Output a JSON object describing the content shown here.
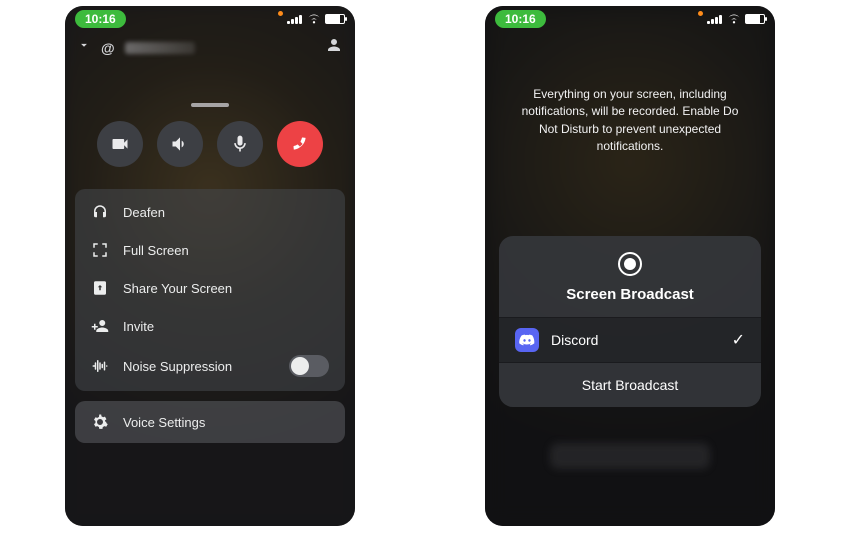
{
  "status": {
    "time": "10:16"
  },
  "left": {
    "header": {
      "at": "@"
    },
    "menu": {
      "deafen": "Deafen",
      "fullscreen": "Full Screen",
      "share": "Share Your Screen",
      "invite": "Invite",
      "noise": "Noise Suppression"
    },
    "voice_settings": "Voice Settings"
  },
  "right": {
    "broadcast_msg": "Everything on your screen, including notifications, will be recorded. Enable Do Not Disturb to prevent unexpected notifications.",
    "card": {
      "title": "Screen Broadcast",
      "app": "Discord",
      "start": "Start Broadcast"
    }
  }
}
